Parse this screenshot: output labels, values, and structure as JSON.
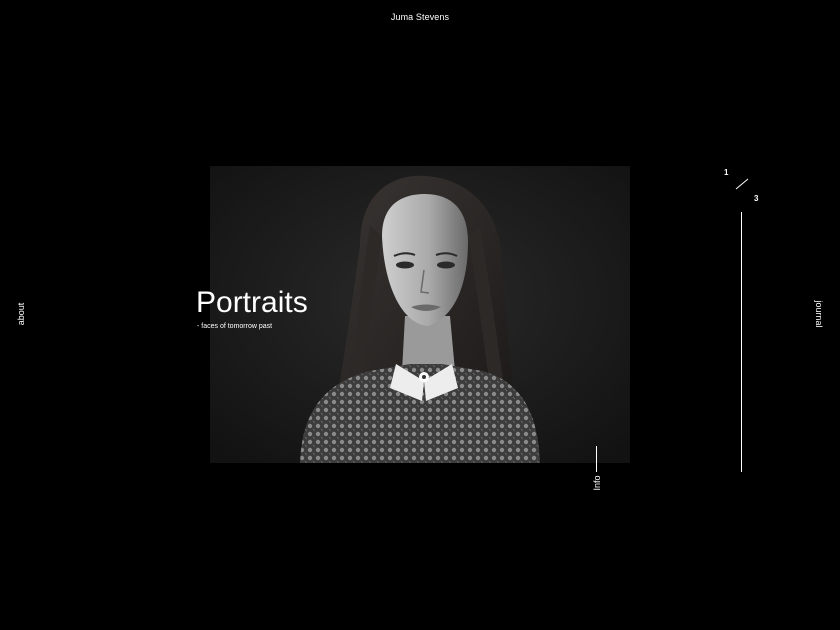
{
  "header": {
    "site_name": "Juma Stevens"
  },
  "nav": {
    "left_label": "about",
    "right_label": "journal"
  },
  "project": {
    "title": "Portraits",
    "subtitle": "- faces of tomorrow past",
    "info_label": "Info"
  },
  "slider": {
    "current": "1",
    "total": "3"
  }
}
